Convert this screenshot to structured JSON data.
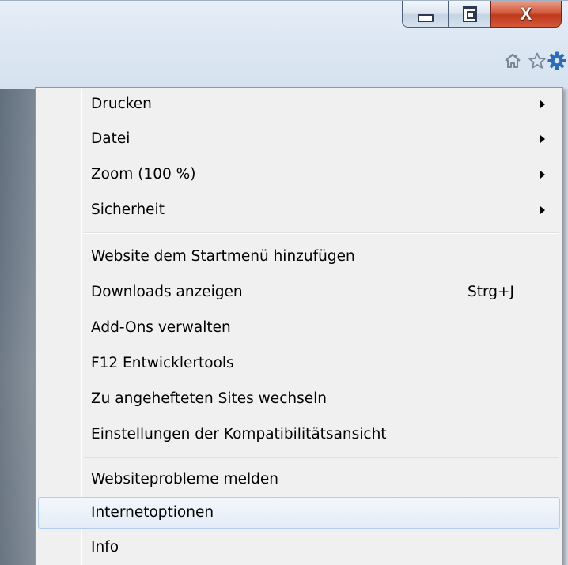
{
  "window": {
    "caption_buttons": {
      "minimize_icon": "minimize-icon",
      "maximize_icon": "maximize-icon",
      "close_label": "X"
    },
    "toolbar": {
      "icons": [
        "home-icon",
        "star-icon",
        "gear-icon"
      ],
      "gear_color": "#2a6cc0"
    }
  },
  "menu": {
    "items": [
      {
        "label": "Drucken",
        "submenu": true
      },
      {
        "label": "Datei",
        "submenu": true
      },
      {
        "label": "Zoom (100 %)",
        "submenu": true
      },
      {
        "label": "Sicherheit",
        "submenu": true
      },
      {
        "label": "Website dem Startmenü hinzufügen"
      },
      {
        "label": "Downloads anzeigen",
        "shortcut": "Strg+J"
      },
      {
        "label": "Add-Ons verwalten"
      },
      {
        "label": "F12 Entwicklertools"
      },
      {
        "label": "Zu angehefteten Sites wechseln"
      },
      {
        "label": "Einstellungen der Kompatibilitätsansicht"
      },
      {
        "label": "Websiteprobleme melden"
      },
      {
        "label": "Internetoptionen",
        "highlighted": true
      },
      {
        "label": "Info"
      }
    ]
  }
}
